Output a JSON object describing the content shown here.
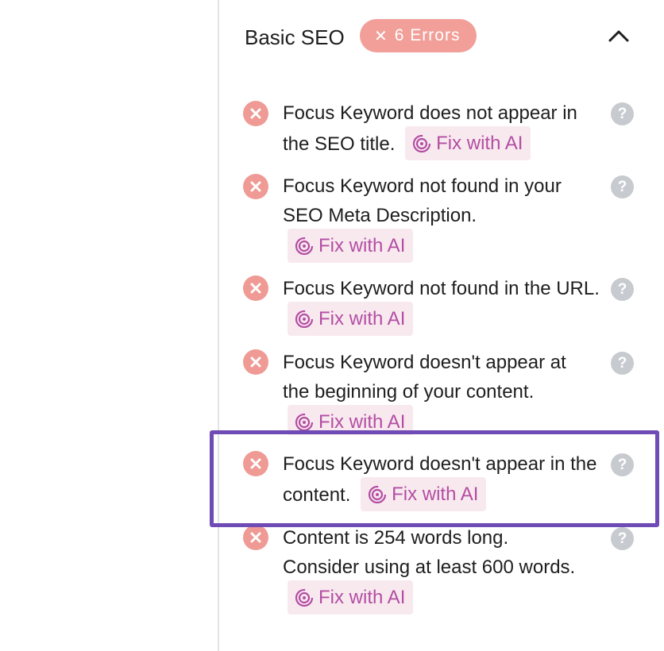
{
  "section": {
    "title": "Basic SEO",
    "badge": {
      "icon": "x-icon",
      "label": "6 Errors",
      "color": "#f19f98"
    },
    "collapse_icon": "chevron-up-icon"
  },
  "fix_label": "Fix with AI",
  "colors": {
    "error": "#ef9a94",
    "fix_bg": "#f8e9ef",
    "fix_text": "#b34ea3",
    "highlight": "#6f4bb5",
    "help": "#c7cacf"
  },
  "items": [
    {
      "text": "Focus Keyword does not appear in the SEO title.",
      "fix": "Fix with AI",
      "help": "?"
    },
    {
      "text": "Focus Keyword not found in your SEO Meta Description.",
      "fix": "Fix with AI",
      "help": "?"
    },
    {
      "text": "Focus Keyword not found in the URL.",
      "fix": "Fix with AI",
      "help": "?"
    },
    {
      "text": "Focus Keyword doesn't appear at the beginning of your content.",
      "fix": "Fix with AI",
      "help": "?"
    },
    {
      "text": "Focus Keyword doesn't appear in the content.",
      "fix": "Fix with AI",
      "help": "?",
      "highlighted": true
    },
    {
      "text": "Content is 254 words long. Consider using at least 600 words.",
      "fix": "Fix with AI",
      "help": "?"
    }
  ]
}
